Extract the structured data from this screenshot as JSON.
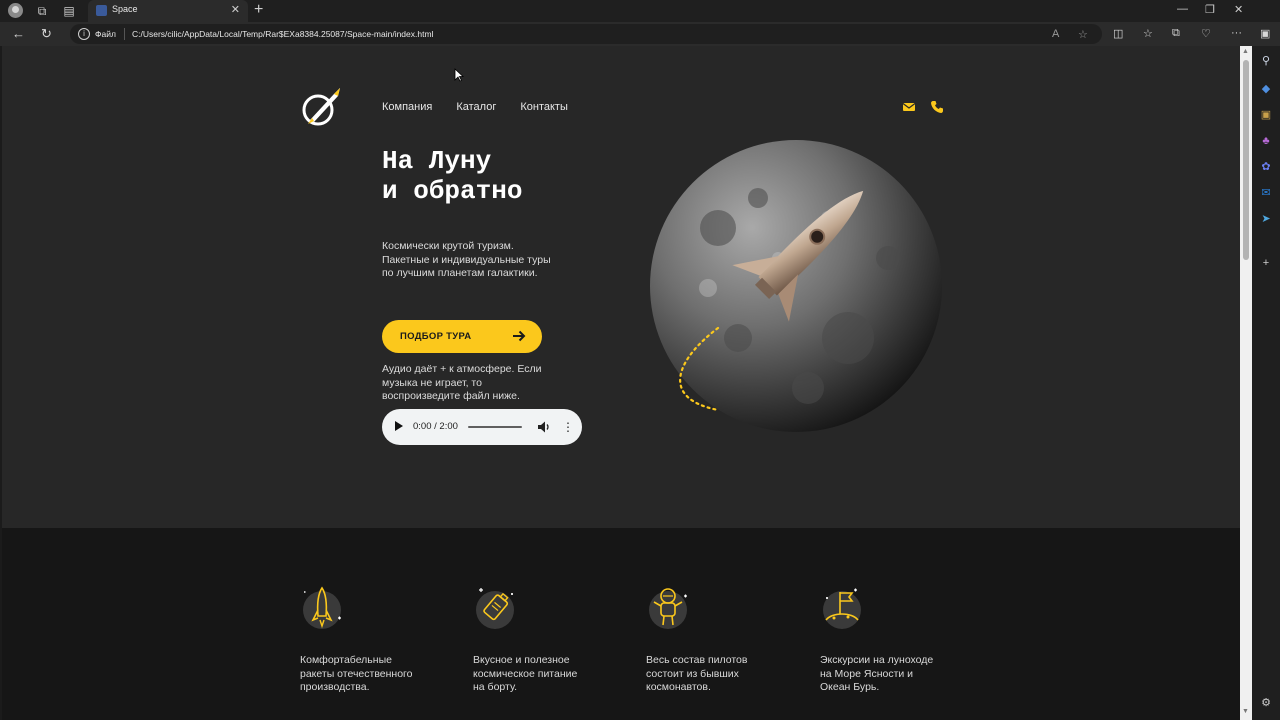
{
  "browser": {
    "tab_title": "Space",
    "file_label": "Файл",
    "url": "C:/Users/cilic/AppData/Local/Temp/Rar$EXa8384.25087/Space-main/index.html"
  },
  "nav": {
    "items": [
      "Компания",
      "Каталог",
      "Контакты"
    ]
  },
  "hero": {
    "title": "На Луну\nи обратно",
    "description": "Космически крутой туризм.\nПакетные и индивидуальные туры\nпо лучшим планетам галактики.",
    "cta_label": "ПОДБОР ТУРА",
    "audio_note": "Аудио даёт + к атмосфере. Если\nмузыка не играет, то\nвоспроизведите файл ниже."
  },
  "player": {
    "time": "0:00 / 2:00"
  },
  "features": [
    {
      "icon": "rocket-icon",
      "text": "Комфортабельные\nракеты отечественного\nпроизводства."
    },
    {
      "icon": "space-food-icon",
      "text": "Вкусное и полезное\nкосмическое питание\nна борту."
    },
    {
      "icon": "astronaut-icon",
      "text": "Весь состав пилотов\nсостоит из бывших\nкосмонавтов."
    },
    {
      "icon": "moon-flag-icon",
      "text": "Экскурсии на луноходе\nна Море Ясности и\nОкеан Бурь."
    }
  ],
  "colors": {
    "accent": "#fbc81c",
    "hero_bg": "#272727",
    "features_bg": "#161616"
  }
}
